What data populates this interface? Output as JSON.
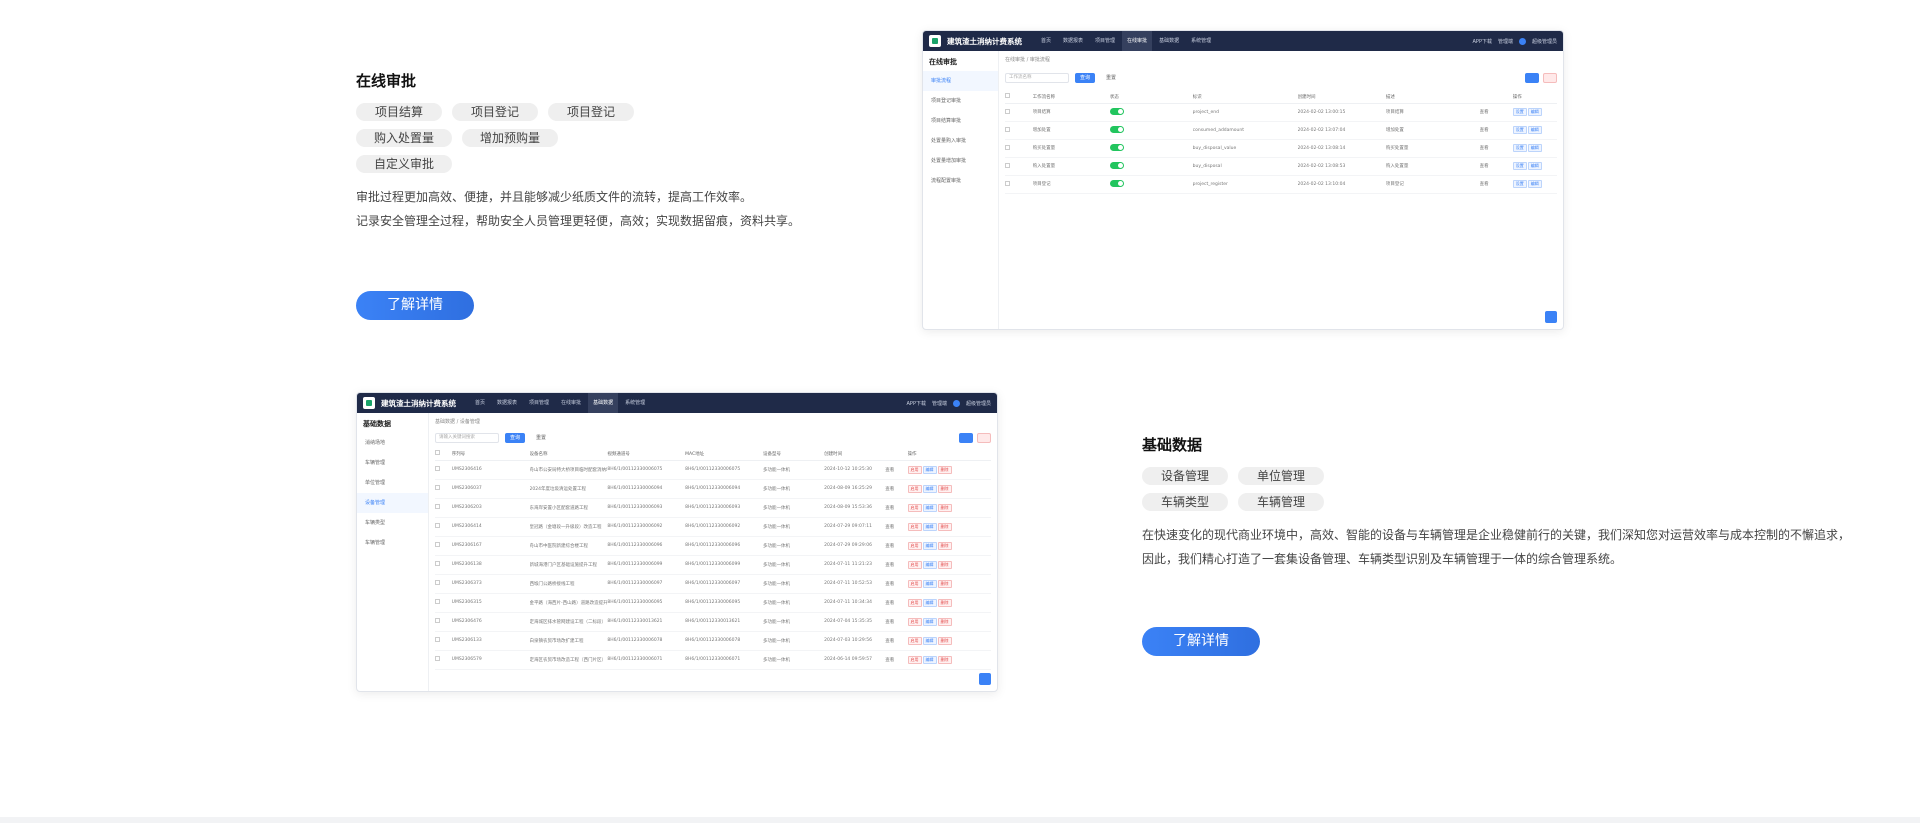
{
  "section1": {
    "title": "在线审批",
    "tags": [
      "项目结算",
      "项目登记",
      "项目登记",
      "购入处置量",
      "增加预购量",
      "自定义审批"
    ],
    "desc": [
      "审批过程更加高效、便捷，并且能够减少纸质文件的流转，提高工作效率。",
      "记录安全管理全过程，帮助安全人员管理更轻便，高效；实现数据留痕，资料共享。"
    ],
    "cta": "了解详情"
  },
  "section2": {
    "title": "基础数据",
    "tags": [
      "设备管理",
      "单位管理",
      "车辆类型",
      "车辆管理"
    ],
    "desc": [
      "在快速变化的现代商业环境中，高效、智能的设备与车辆管理是企业稳健前行的关键，我们深知您对运营效率与成本控制的不懈追求，",
      "因此，我们精心打造了一套集设备管理、车辆类型识别及车辆管理于一体的综合管理系统。"
    ],
    "cta": "了解详情"
  },
  "shot1": {
    "app_title": "建筑渣土消纳计费系统",
    "nav": [
      "首页",
      "数据报表",
      "项目管理",
      "在线审批",
      "基础数据",
      "系统管理"
    ],
    "active_nav": 3,
    "topright": [
      "APP下载",
      "管理端"
    ],
    "user": "超级管理员",
    "side_title": "在线审批",
    "side": [
      "审批流程",
      "项目登记审批",
      "项目结算审批",
      "处置量购入审批",
      "处置量增加审批",
      "流程配置审批"
    ],
    "active_side": 0,
    "crumb": "在线审批 / 审批流程",
    "search_placeholder": "工作流名称",
    "search_btn": "查询",
    "reset_btn": "重置",
    "headers": [
      "",
      "工作流名称",
      "状态",
      "标识",
      "创建时间",
      "描述",
      "",
      "操作"
    ],
    "rows": [
      [
        "项目结算",
        "project_end",
        "2024-02-02 13:00:15",
        "项目结算"
      ],
      [
        "增加处置",
        "consumed_addamount",
        "2024-02-02 13:07:04",
        "增加处置"
      ],
      [
        "购买处置量",
        "buy_disposal_value",
        "2024-02-02 13:08:14",
        "购买处置量"
      ],
      [
        "购入处置量",
        "buy_disposal",
        "2024-02-02 13:08:53",
        "购入处置量"
      ],
      [
        "项目登记",
        "project_register",
        "2024-02-02 13:10:04",
        "项目登记"
      ]
    ],
    "row_ops": [
      "查看",
      "设置",
      "编辑"
    ]
  },
  "shot2": {
    "app_title": "建筑渣土消纳计费系统",
    "nav": [
      "首页",
      "数据报表",
      "项目管理",
      "在线审批",
      "基础数据",
      "系统管理"
    ],
    "active_nav": 4,
    "topright": [
      "APP下载",
      "管理端"
    ],
    "user": "超级管理员",
    "side_title": "基础数据",
    "side": [
      "消纳场地",
      "车辆管理",
      "单位管理",
      "设备管理",
      "车辆类型",
      "车辆管理"
    ],
    "active_side": 3,
    "crumb": "基础数据 / 设备管理",
    "search_placeholder": "请输入关键词搜索",
    "search_btn": "查询",
    "reset_btn": "重置",
    "headers": [
      "",
      "序列号",
      "设备名称",
      "视频通道号",
      "MAC地址",
      "设备型号",
      "创建时间",
      "",
      "操作"
    ],
    "rows": [
      [
        "UMS2306416",
        "舟山市公安局特大桥项目临时配套消纳场设备",
        "8H6/1/00112330006075",
        "8H6/1/00112330006075",
        "多功能一体机",
        "2024-10-12 10:25:30"
      ],
      [
        "UMS2306037",
        "2024年度垃圾清运处置工程",
        "8H6/1/00112330006094",
        "8H6/1/00112330006094",
        "多功能一体机",
        "2024-08-09 16:25:29"
      ],
      [
        "UMS2306203",
        "东海岸安置小区配套道路工程",
        "8H6/1/00112330006093",
        "8H6/1/00112330006093",
        "多功能一体机",
        "2024-08-09 15:53:36"
      ],
      [
        "UMS2306414",
        "皇冠路（金塘段一升级段）改造工程",
        "8H6/1/00112330006092",
        "8H6/1/00112330006092",
        "多功能一体机",
        "2024-07-29 09:07:11"
      ],
      [
        "UMS2306167",
        "舟山市中医院新建综合楼工程",
        "8H6/1/00112330006096",
        "8H6/1/00112330006096",
        "多功能一体机",
        "2024-07-29 09:29:06"
      ],
      [
        "UMS2306138",
        "新城海港门户区基础设施提升工程",
        "8H6/1/00112330006099",
        "8H6/1/00112330006099",
        "多功能一体机",
        "2024-07-11 11:21:23"
      ],
      [
        "UMS2306373",
        "西堠门公路桥接线工程",
        "8H6/1/00112330006097",
        "8H6/1/00112330006097",
        "多功能一体机",
        "2024-07-11 10:52:53"
      ],
      [
        "UMS2306315",
        "金平路（海西片-西山路）道路改造提升工程",
        "8H6/1/00112330006095",
        "8H6/1/00112330006095",
        "多功能一体机",
        "2024-07-11 10:34:34"
      ],
      [
        "UMS2306476",
        "定海城区排水管网建设工程（二标段）",
        "8H6/1/00112330013621",
        "8H6/1/00112330013621",
        "多功能一体机",
        "2024-07-04 15:35:35"
      ],
      [
        "UMS2306133",
        "白泉镇农贸市场改扩建工程",
        "8H6/1/00112330006078",
        "8H6/1/00112330006078",
        "多功能一体机",
        "2024-07-03 10:29:56"
      ],
      [
        "UMS2306579",
        "定海区农贸市场改造工程（西门片区）",
        "8H6/1/00112330006071",
        "8H6/1/00112330006071",
        "多功能一体机",
        "2024-06-14 09:59:57"
      ]
    ],
    "row_ops": [
      "查看",
      "启用",
      "编辑",
      "删除"
    ]
  }
}
